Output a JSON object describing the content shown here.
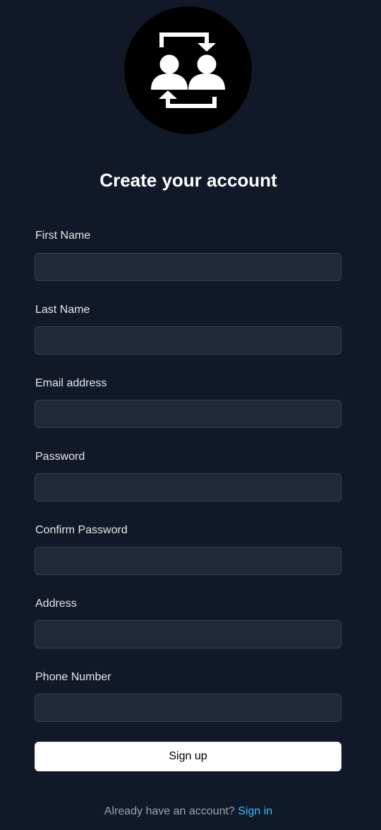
{
  "logo": {
    "icon": "user-swap-icon"
  },
  "title": "Create your account",
  "form": {
    "fields": [
      {
        "label": "First Name",
        "value": "",
        "placeholder": "",
        "type": "text"
      },
      {
        "label": "Last Name",
        "value": "",
        "placeholder": "",
        "type": "text"
      },
      {
        "label": "Email address",
        "value": "",
        "placeholder": "",
        "type": "email"
      },
      {
        "label": "Password",
        "value": "",
        "placeholder": "",
        "type": "password"
      },
      {
        "label": "Confirm Password",
        "value": "",
        "placeholder": "",
        "type": "password"
      },
      {
        "label": "Address",
        "value": "",
        "placeholder": "",
        "type": "text"
      },
      {
        "label": "Phone Number",
        "value": "",
        "placeholder": "",
        "type": "tel"
      }
    ],
    "submit_label": "Sign up"
  },
  "footer": {
    "prompt": "Already have an account?",
    "link_label": "Sign in"
  },
  "colors": {
    "background": "#111827",
    "input_background": "#1f2937",
    "link": "#38bdf8"
  }
}
